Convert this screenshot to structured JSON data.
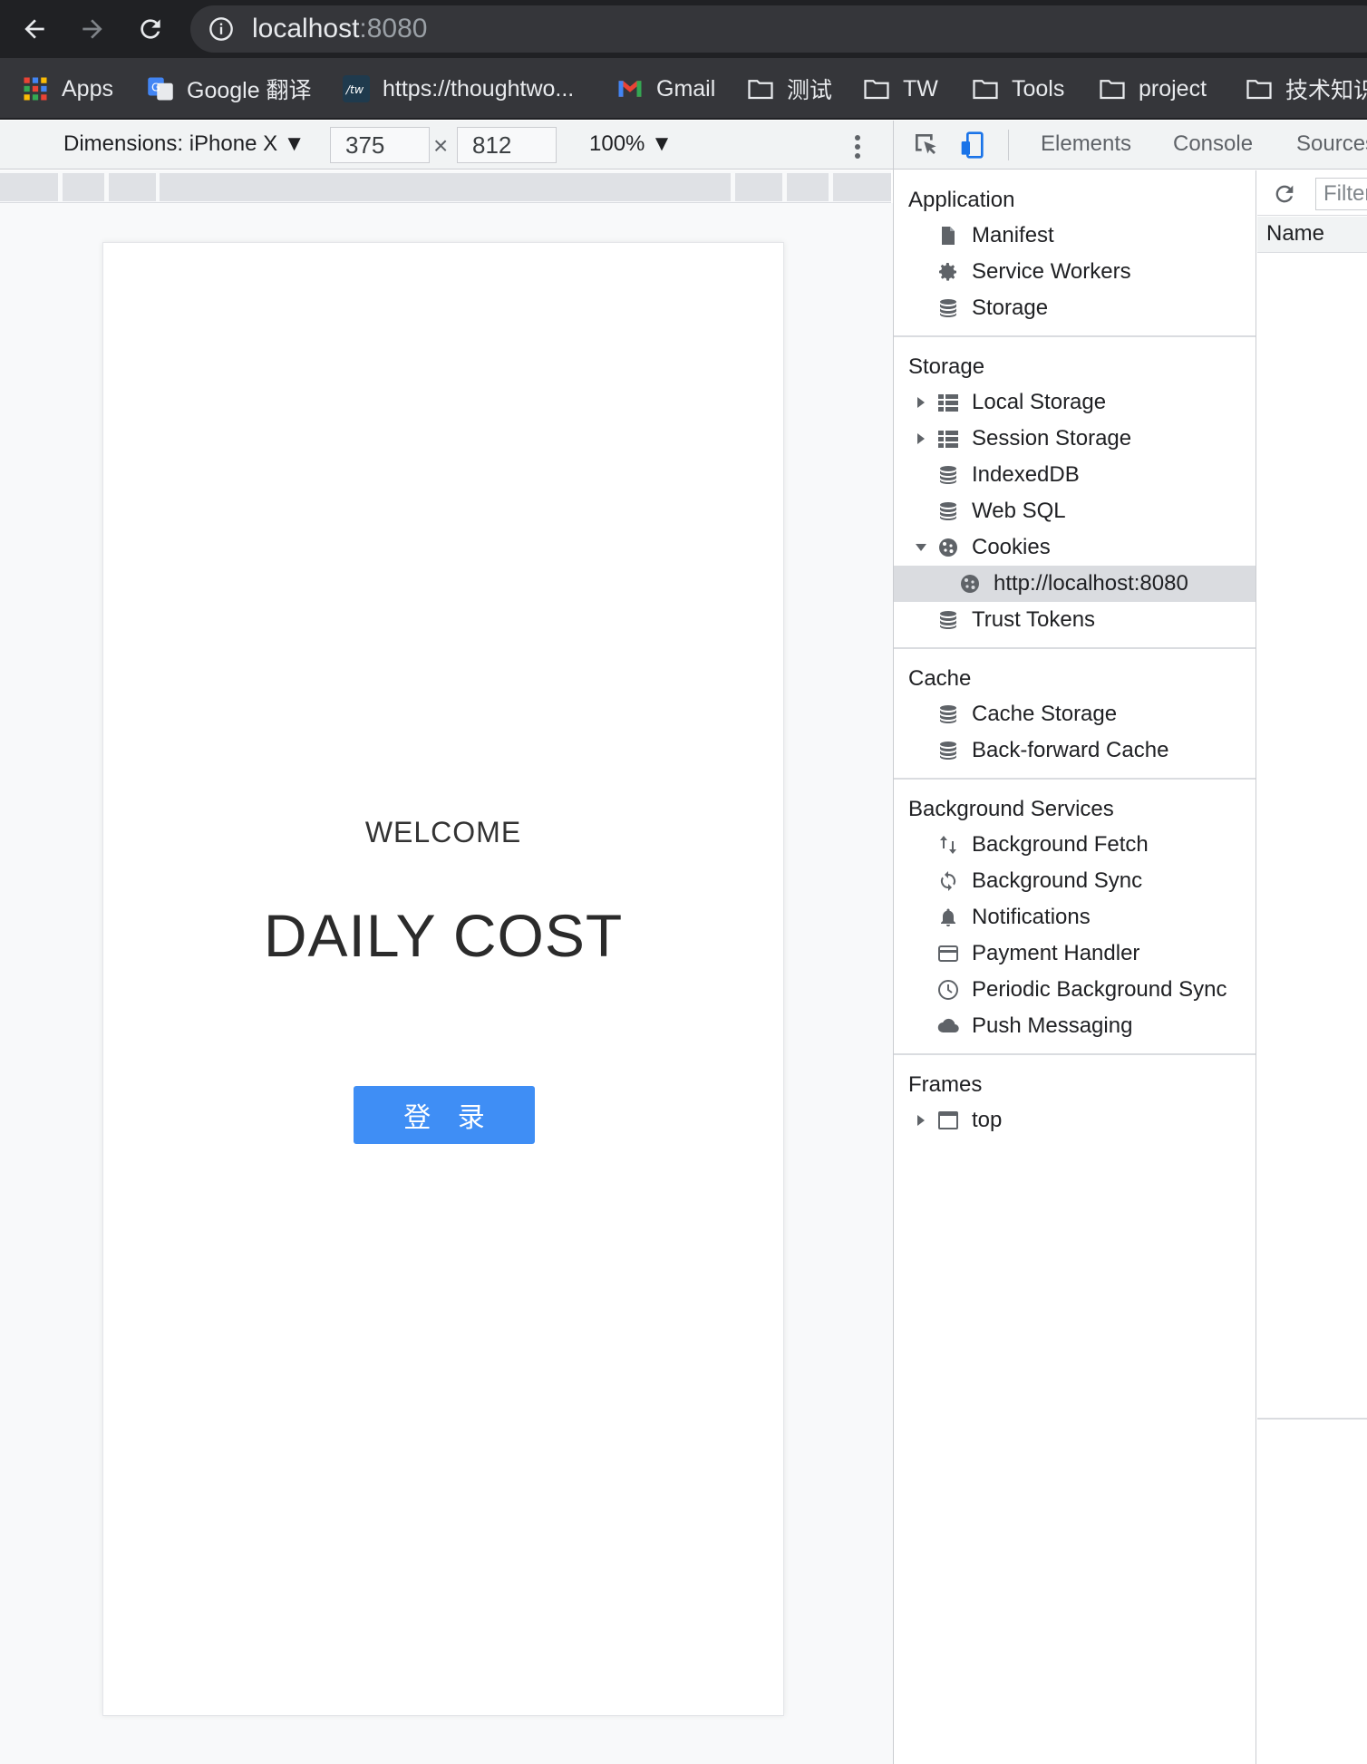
{
  "browser": {
    "url_host": "localhost",
    "url_port": ":8080",
    "bookmarks": [
      {
        "label": "Apps",
        "icon": "apps-grid-icon"
      },
      {
        "label": "Google 翻译",
        "icon": "google-translate-icon"
      },
      {
        "label": "https://thoughtwo...",
        "icon": "thoughtworks-icon"
      },
      {
        "label": "Gmail",
        "icon": "gmail-icon"
      },
      {
        "label": "测试",
        "icon": "folder-icon"
      },
      {
        "label": "TW",
        "icon": "folder-icon"
      },
      {
        "label": "Tools",
        "icon": "folder-icon"
      },
      {
        "label": "project",
        "icon": "folder-icon"
      },
      {
        "label": "技术知识",
        "icon": "folder-icon"
      }
    ]
  },
  "device_toolbar": {
    "dimensions_label": "Dimensions: iPhone X",
    "width_value": "375",
    "height_value": "812",
    "times_sign": "×",
    "zoom_label": "100%"
  },
  "app": {
    "welcome": "WELCOME",
    "title": "DAILY COST",
    "login_button": "登 录",
    "login_color": "#3f8ef5"
  },
  "devtools": {
    "tabs": [
      "Elements",
      "Console",
      "Sources"
    ],
    "sections": [
      {
        "title": "Application",
        "items": [
          "Manifest",
          "Service Workers",
          "Storage"
        ]
      },
      {
        "title": "Storage",
        "items": [
          "Local Storage",
          "Session Storage",
          "IndexedDB",
          "Web SQL",
          "Cookies",
          "http://localhost:8080",
          "Trust Tokens"
        ]
      },
      {
        "title": "Cache",
        "items": [
          "Cache Storage",
          "Back-forward Cache"
        ]
      },
      {
        "title": "Background Services",
        "items": [
          "Background Fetch",
          "Background Sync",
          "Notifications",
          "Payment Handler",
          "Periodic Background Sync",
          "Push Messaging"
        ]
      },
      {
        "title": "Frames",
        "items": [
          "top"
        ]
      }
    ],
    "filter_placeholder": "Filter",
    "column_header": "Name"
  }
}
